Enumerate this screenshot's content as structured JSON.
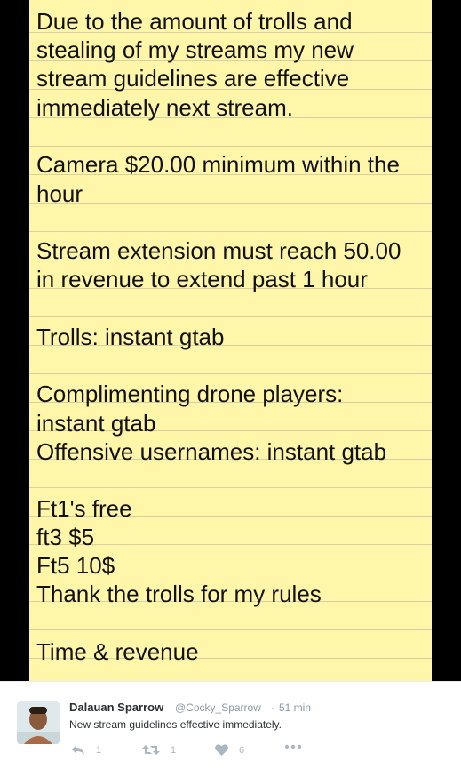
{
  "note_lines": [
    "Due to the amount of trolls and",
    "stealing of my streams my new",
    "stream guidelines are effective",
    "immediately next stream.",
    "Camera $20.00 minimum within the",
    "hour",
    "Stream extension must reach 50.00",
    "in revenue to extend past 1 hour",
    "Trolls: instant gtab",
    "Complimenting drone players:",
    "instant gtab",
    "Offensive usernames: instant gtab",
    "Ft1's free",
    "ft3 $5",
    "Ft5 10$",
    "Thank the trolls for my rules",
    "Time & revenue"
  ],
  "tweet": {
    "display_name": "Dalauan Sparrow",
    "handle": "@Cocky_Sparrow",
    "separator": "·",
    "time": "51 min",
    "text": "New stream guidelines effective immediately.",
    "reply_count": "1",
    "retweet_count": "1",
    "like_count": "6"
  },
  "icons": {
    "reply": "reply-icon",
    "retweet": "retweet-icon",
    "like": "heart-icon",
    "more": "more-dots-icon"
  },
  "colors": {
    "note_bg": "#fff6a9",
    "icon_gray": "#aab8c2",
    "muted_text": "#8899a6"
  }
}
